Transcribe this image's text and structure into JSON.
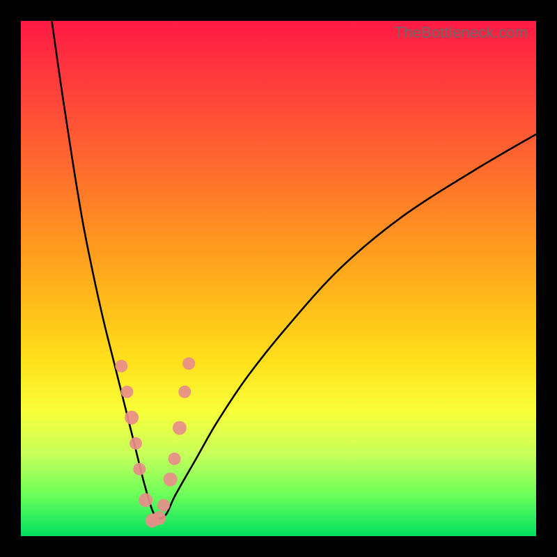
{
  "watermark": "TheBottleneck.com",
  "chart_data": {
    "type": "line",
    "title": "",
    "xlabel": "",
    "ylabel": "",
    "xlim": [
      0,
      100
    ],
    "ylim": [
      0,
      100
    ],
    "grid": false,
    "legend": false,
    "description": "V-shaped bottleneck curve over a red-to-green vertical gradient; minimum near x≈25",
    "curve_min_x": 25,
    "series": [
      {
        "name": "bottleneck-curve",
        "x": [
          6,
          8,
          10,
          12,
          14,
          16,
          18,
          20,
          22,
          24,
          26,
          28,
          30,
          34,
          38,
          44,
          52,
          62,
          74,
          88,
          100
        ],
        "y": [
          100,
          86,
          73,
          61,
          51,
          42,
          34,
          26,
          18,
          10,
          4,
          4,
          8,
          15,
          22,
          31,
          41,
          52,
          62,
          71,
          78
        ]
      }
    ],
    "points": {
      "name": "highlight-dots",
      "x": [
        19.5,
        20.6,
        21.5,
        22.3,
        23.0,
        24.2,
        25.5,
        26.8,
        27.7,
        29.0,
        29.8,
        30.8,
        31.8,
        32.6
      ],
      "y": [
        33.0,
        28.0,
        23.0,
        18.0,
        13.0,
        7.0,
        3.0,
        3.5,
        6.0,
        11.0,
        15.0,
        21.0,
        28.0,
        33.5
      ],
      "r": [
        9,
        9,
        10,
        9,
        9,
        10,
        10,
        10,
        9,
        10,
        9,
        10,
        9,
        9
      ]
    }
  }
}
